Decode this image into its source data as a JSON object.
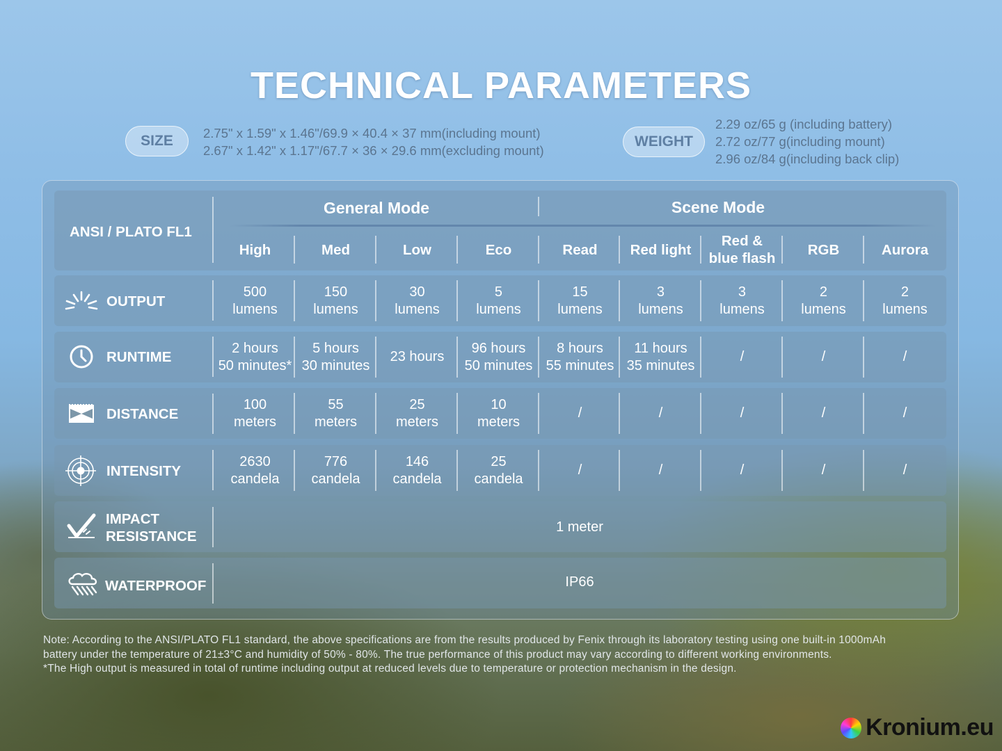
{
  "title": "TECHNICAL PARAMETERS",
  "size": {
    "label": "SIZE",
    "lines": [
      "2.75\" x 1.59\" x 1.46\"/69.9 × 40.4 × 37 mm(including mount)",
      "2.67\" x 1.42\" x 1.17\"/67.7 × 36 × 29.6 mm(excluding mount)"
    ]
  },
  "weight": {
    "label": "WEIGHT",
    "lines": [
      "2.29 oz/65 g (including battery)",
      "2.72 oz/77 g(including mount)",
      "2.96 oz/84 g(including back clip)"
    ]
  },
  "table": {
    "standard": "ANSI / PLATO FL1",
    "groups": {
      "general": "General Mode",
      "scene": "Scene Mode"
    },
    "modes": [
      "High",
      "Med",
      "Low",
      "Eco",
      "Read",
      "Red light",
      "Red &\nblue flash",
      "RGB",
      "Aurora"
    ],
    "rows": [
      {
        "label": "OUTPUT",
        "icon": "output-burst-icon",
        "values": [
          "500\nlumens",
          "150\nlumens",
          "30\nlumens",
          "5\nlumens",
          "15\nlumens",
          "3\nlumens",
          "3\nlumens",
          "2\nlumens",
          "2\nlumens"
        ]
      },
      {
        "label": "RUNTIME",
        "icon": "clock-icon",
        "values": [
          "2 hours\n50 minutes*",
          "5 hours\n30 minutes",
          "23 hours",
          "96 hours\n50 minutes",
          "8 hours\n55 minutes",
          "11 hours\n35 minutes",
          "/",
          "/",
          "/"
        ]
      },
      {
        "label": "DISTANCE",
        "icon": "distance-icon",
        "values": [
          "100\nmeters",
          "55\nmeters",
          "25\nmeters",
          "10\nmeters",
          "/",
          "/",
          "/",
          "/",
          "/"
        ]
      },
      {
        "label": "INTENSITY",
        "icon": "target-icon",
        "values": [
          "2630\ncandela",
          "776\ncandela",
          "146\ncandela",
          "25\ncandela",
          "/",
          "/",
          "/",
          "/",
          "/"
        ]
      }
    ],
    "impact": {
      "label": "IMPACT\nRESISTANCE",
      "icon": "impact-check-icon",
      "value": "1 meter"
    },
    "waterproof": {
      "label": "WATERPROOF",
      "icon": "rain-cloud-icon",
      "value": "IP66"
    }
  },
  "note": [
    "Note: According to the ANSI/PLATO FL1 standard, the above specifications are from the results produced by Fenix through its laboratory testing using one built-in 1000mAh",
    "battery under the temperature of 21±3°C and humidity of 50% - 80%. The true performance of this product may vary according to different working environments.",
    "*The High output is measured in total of runtime including output at reduced levels due to temperature or protection mechanism in the design."
  ],
  "brand": "Kronium.eu"
}
